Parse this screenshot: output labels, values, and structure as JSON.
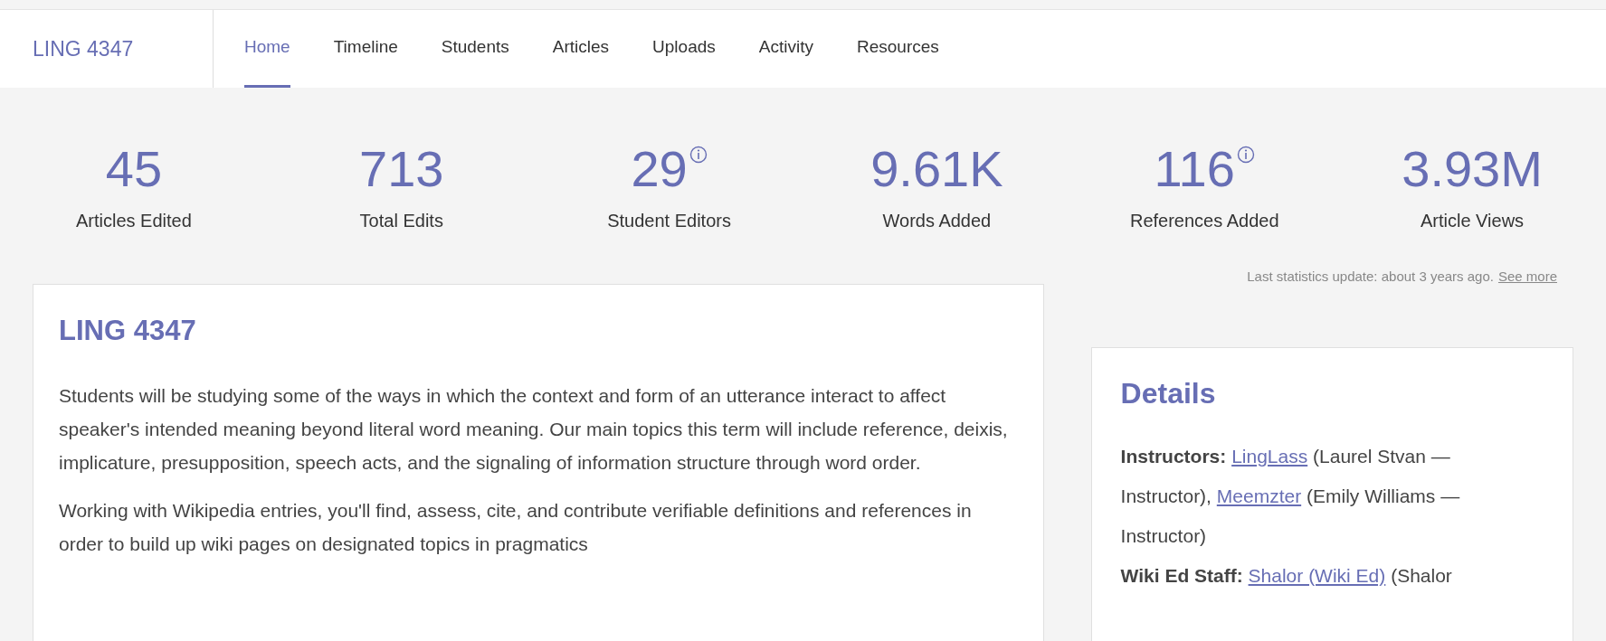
{
  "nav": {
    "course": "LING 4347",
    "tabs": [
      {
        "label": "Home",
        "selected": true
      },
      {
        "label": "Timeline",
        "selected": false
      },
      {
        "label": "Students",
        "selected": false
      },
      {
        "label": "Articles",
        "selected": false
      },
      {
        "label": "Uploads",
        "selected": false
      },
      {
        "label": "Activity",
        "selected": false
      },
      {
        "label": "Resources",
        "selected": false
      }
    ]
  },
  "stats": [
    {
      "value": "45",
      "label": "Articles Edited",
      "info": false
    },
    {
      "value": "713",
      "label": "Total Edits",
      "info": false
    },
    {
      "value": "29",
      "label": "Student Editors",
      "info": true
    },
    {
      "value": "9.61K",
      "label": "Words Added",
      "info": false
    },
    {
      "value": "116",
      "label": "References Added",
      "info": true
    },
    {
      "value": "3.93M",
      "label": "Article Views",
      "info": false
    }
  ],
  "stats_update": {
    "text": "Last statistics update: about 3 years ago.",
    "link": "See more"
  },
  "overview": {
    "title": "LING 4347",
    "paragraphs": [
      "Students will be studying some of the ways in which the context and form of an utterance interact to affect speaker's intended meaning beyond literal word meaning. Our main topics this term will include reference, deixis, implicature, presupposition, speech acts, and the signaling of information structure through word order.",
      "Working with Wikipedia entries, you'll find, assess, cite, and contribute verifiable definitions and references in order to build up wiki pages on designated topics in pragmatics"
    ]
  },
  "details": {
    "title": "Details",
    "items": [
      {
        "label": "Instructors:",
        "segments": [
          {
            "kind": "link",
            "text": "LingLass"
          },
          {
            "kind": "text",
            "text": "(Laurel Stvan — Instructor),"
          },
          {
            "kind": "link",
            "text": "Meemzter"
          },
          {
            "kind": "text",
            "text": "(Emily Williams — Instructor)"
          }
        ]
      },
      {
        "label": "Wiki Ed Staff:",
        "segments": [
          {
            "kind": "link",
            "text": "Shalor (Wiki Ed)"
          },
          {
            "kind": "text",
            "text": "(Shalor"
          }
        ]
      }
    ]
  }
}
